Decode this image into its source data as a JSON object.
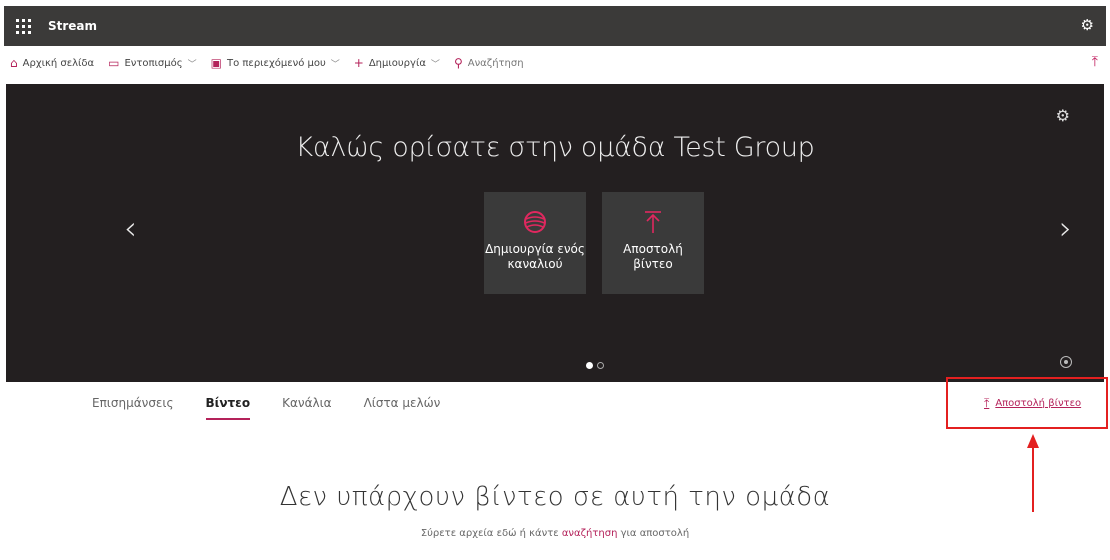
{
  "suitebar": {
    "app_name": "Stream"
  },
  "nav": {
    "home": "Αρχική σελίδα",
    "discover": "Εντοπισμός",
    "my_content": "Το περιεχόμενό μου",
    "create": "Δημιουργία",
    "search": "Αναζήτηση"
  },
  "hero": {
    "title": "Καλώς ορίσατε στην ομάδα Test Group",
    "tiles": [
      {
        "label": "Δημιουργία ενός καναλιού",
        "icon": "channel-icon"
      },
      {
        "label": "Αποστολή βίντεο",
        "icon": "upload-icon"
      }
    ],
    "carousel": {
      "pages": 2,
      "current": 1
    }
  },
  "tabs": [
    {
      "label": "Επισημάνσεις",
      "active": false
    },
    {
      "label": "Βίντεο",
      "active": true
    },
    {
      "label": "Κανάλια",
      "active": false
    },
    {
      "label": "Λίστα μελών",
      "active": false
    }
  ],
  "upload_link": "Αποστολή βίντεο",
  "empty": {
    "title": "Δεν υπάρχουν βίντεο σε αυτή την ομάδα",
    "sub_before": "Σύρετε αρχεία εδώ ή κάντε ",
    "sub_link": "αναζήτηση",
    "sub_after": " για αποστολή"
  },
  "colors": {
    "accent": "#b4225a",
    "suitebar": "#3b3a39",
    "hero_bg": "#231f20",
    "annotation": "#e32020"
  }
}
